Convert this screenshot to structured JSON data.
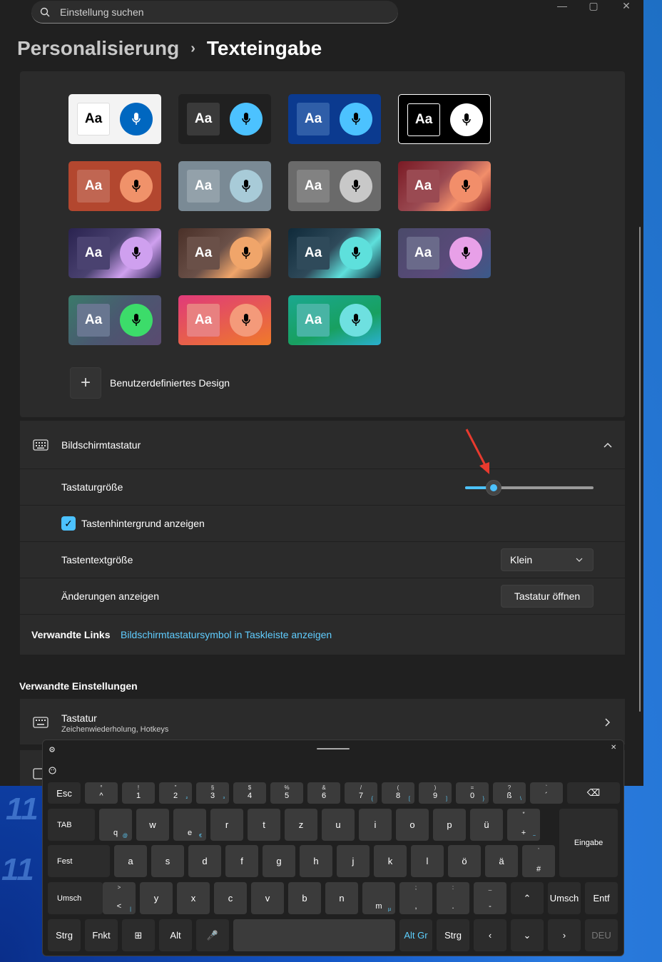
{
  "search": {
    "placeholder": "Einstellung suchen"
  },
  "window_controls": {
    "minimize": "—",
    "maximize": "▢",
    "close": "✕"
  },
  "breadcrumb": {
    "parent": "Personalisierung",
    "separator": "›",
    "current": "Texteingabe"
  },
  "themes": {
    "aa_label": "Aa",
    "tiles": [
      {
        "name": "light",
        "bg": "#f3f3f3",
        "aa_bg": "#ffffff",
        "aa_color": "#000000",
        "mic_bg": "#0067c0",
        "mic_color": "#ffffff"
      },
      {
        "name": "dark",
        "bg": "#202020",
        "aa_bg": "#3a3a3a",
        "aa_color": "#ffffff",
        "mic_bg": "#4cc2ff",
        "mic_color": "#000000"
      },
      {
        "name": "blue",
        "bg": "#0b3a8f",
        "aa_bg": "#2f5ea8",
        "aa_color": "#ffffff",
        "mic_bg": "#4cc2ff",
        "mic_color": "#000000"
      },
      {
        "name": "high-contrast",
        "bg": "#000000",
        "aa_bg": "#000000",
        "aa_color": "#ffffff",
        "mic_bg": "#ffffff",
        "mic_color": "#000000"
      },
      {
        "name": "rust",
        "bg": "#b3472f",
        "aa_bg": "#c06652",
        "aa_color": "#ffffff",
        "mic_bg": "#f0926a",
        "mic_color": "#000000"
      },
      {
        "name": "slate",
        "bg": "#7a8a95",
        "aa_bg": "#93a1aa",
        "aa_color": "#ffffff",
        "mic_bg": "#a8cbd8",
        "mic_color": "#000000"
      },
      {
        "name": "gray",
        "bg": "#6a6a6a",
        "aa_bg": "#828282",
        "aa_color": "#ffffff",
        "mic_bg": "#c8c8c8",
        "mic_color": "#000000"
      },
      {
        "name": "red-wave",
        "bg": "#7a1a24",
        "aa_bg": "#9a4a52",
        "aa_color": "#ffffff",
        "mic_bg": "#f28e6a",
        "mic_color": "#000000"
      },
      {
        "name": "purple-wave",
        "bg": "#2a2350",
        "aa_bg": "#4a4270",
        "aa_color": "#ffffff",
        "mic_bg": "#cfa0ef",
        "mic_color": "#000000"
      },
      {
        "name": "bronze-wave",
        "bg": "#4a3028",
        "aa_bg": "#6a5048",
        "aa_color": "#ffffff",
        "mic_bg": "#f0a56a",
        "mic_color": "#000000"
      },
      {
        "name": "teal-wave",
        "bg": "#0f2a3a",
        "aa_bg": "#2f4a5a",
        "aa_color": "#ffffff",
        "mic_bg": "#5ee0dc",
        "mic_color": "#000000"
      },
      {
        "name": "lilac",
        "bg": "#4a4a70",
        "aa_bg": "#6a6a8a",
        "aa_color": "#ffffff",
        "mic_bg": "#e8a0e8",
        "mic_color": "#000000"
      },
      {
        "name": "green",
        "bg": "#4a5870",
        "aa_bg": "#687690",
        "aa_color": "#ffffff",
        "mic_bg": "#3cdc6a",
        "mic_color": "#000000"
      },
      {
        "name": "sunset",
        "bg": "#e0506a",
        "aa_bg": "#e88080",
        "aa_color": "#ffffff",
        "mic_bg": "#f49a7a",
        "mic_color": "#000000"
      },
      {
        "name": "aqua",
        "bg": "#1ea088",
        "aa_bg": "#48b4a4",
        "aa_color": "#ffffff",
        "mic_bg": "#6ee0e0",
        "mic_color": "#000000"
      }
    ],
    "custom_label": "Benutzerdefiniertes Design",
    "custom_plus": "+"
  },
  "onscreen": {
    "title": "Bildschirmtastatur",
    "size_label": "Tastaturgröße",
    "size_fraction": 0.22,
    "show_bg_label": "Tastenhintergrund anzeigen",
    "show_bg_checked": "✓",
    "text_size_label": "Tastentextgröße",
    "text_size_value": "Klein",
    "changes_label": "Änderungen anzeigen",
    "open_button": "Tastatur öffnen",
    "related_links_label": "Verwandte Links",
    "related_link": "Bildschirmtastatursymbol in Taskleiste anzeigen"
  },
  "related_settings": {
    "title": "Verwandte Einstellungen",
    "keyboard_title": "Tastatur",
    "keyboard_sub": "Zeichenwiederholung, Hotkeys"
  },
  "desktop_numbers": [
    "11",
    "11"
  ],
  "osk": {
    "close": "✕",
    "rows": {
      "r1": [
        {
          "m": "Esc"
        },
        {
          "u": "°",
          "m": "^"
        },
        {
          "u": "!",
          "m": "1"
        },
        {
          "u": "\"",
          "m": "2",
          "a": "²"
        },
        {
          "u": "§",
          "m": "3",
          "a": "³"
        },
        {
          "u": "$",
          "m": "4"
        },
        {
          "u": "%",
          "m": "5"
        },
        {
          "u": "&",
          "m": "6"
        },
        {
          "u": "/",
          "m": "7",
          "a": "{"
        },
        {
          "u": "(",
          "m": "8",
          "a": "["
        },
        {
          "u": ")",
          "m": "9",
          "a": "]"
        },
        {
          "u": "=",
          "m": "0",
          "a": "}"
        },
        {
          "u": "?",
          "m": "ß",
          "a": "\\"
        },
        {
          "u": "`",
          "m": "´"
        },
        {
          "m": "⌫"
        }
      ],
      "r2": [
        {
          "m": "TAB"
        },
        {
          "m": "q",
          "a": "@"
        },
        {
          "m": "w"
        },
        {
          "m": "e",
          "a": "€"
        },
        {
          "m": "r"
        },
        {
          "m": "t"
        },
        {
          "m": "z"
        },
        {
          "m": "u"
        },
        {
          "m": "i"
        },
        {
          "m": "o"
        },
        {
          "m": "p"
        },
        {
          "m": "ü"
        },
        {
          "u": "*",
          "m": "+",
          "a": "~"
        }
      ],
      "enter": "Eingabe",
      "r3": [
        {
          "m": "Fest"
        },
        {
          "m": "a"
        },
        {
          "m": "s"
        },
        {
          "m": "d"
        },
        {
          "m": "f"
        },
        {
          "m": "g"
        },
        {
          "m": "h"
        },
        {
          "m": "j"
        },
        {
          "m": "k"
        },
        {
          "m": "l"
        },
        {
          "m": "ö"
        },
        {
          "m": "ä"
        },
        {
          "u": "'",
          "m": "#"
        }
      ],
      "r4": [
        {
          "m": "Umsch"
        },
        {
          "u": ">",
          "m": "<",
          "a": "|"
        },
        {
          "m": "y"
        },
        {
          "m": "x"
        },
        {
          "m": "c"
        },
        {
          "m": "v"
        },
        {
          "m": "b"
        },
        {
          "m": "n"
        },
        {
          "m": "m",
          "a": "µ"
        },
        {
          "u": ";",
          "m": ","
        },
        {
          "u": ":",
          "m": "."
        },
        {
          "u": "_",
          "m": "-"
        },
        {
          "m": "⌃"
        },
        {
          "m": "Umsch"
        },
        {
          "m": "Entf"
        }
      ],
      "r5": [
        {
          "m": "Strg"
        },
        {
          "m": "Fnkt"
        },
        {
          "m": "⊞"
        },
        {
          "m": "Alt"
        },
        {
          "m": "🎤"
        },
        {
          "m": ""
        },
        {
          "m": "Alt Gr"
        },
        {
          "m": "Strg"
        },
        {
          "m": "‹"
        },
        {
          "m": "⌄"
        },
        {
          "m": "›"
        },
        {
          "m": "DEU"
        }
      ]
    }
  }
}
